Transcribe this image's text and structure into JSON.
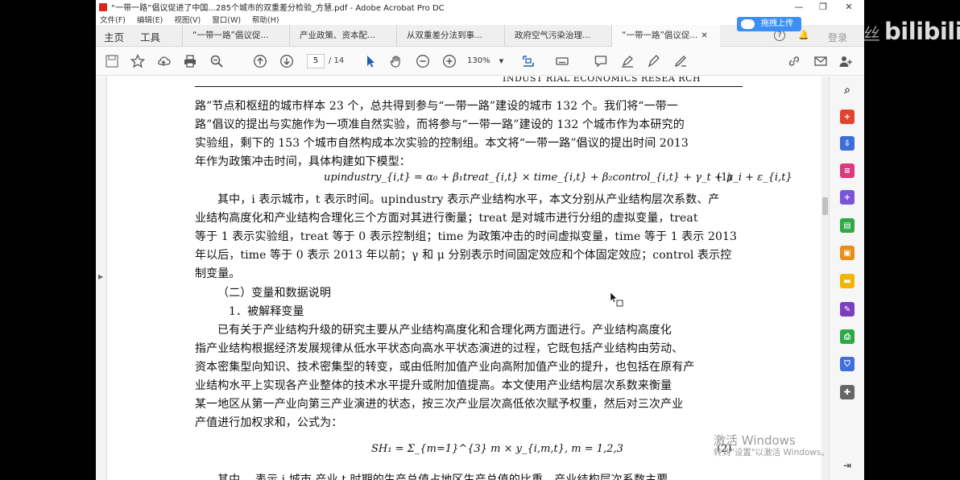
{
  "window": {
    "title": "“一带一路”倡议促进了中国...285个城市的双重差分检验_方慧.pdf - Adobe Acrobat Pro DC",
    "menu": [
      "文件(F)",
      "编辑(E)",
      "视图(V)",
      "窗口(W)",
      "帮助(H)"
    ],
    "controls": {
      "minimize": "—",
      "maximize": "❐",
      "close": "✕"
    }
  },
  "tabs": {
    "home": "主页",
    "tools": "工具",
    "docs": [
      "“一带一路”倡议促...",
      "产业政策、资本配...",
      "从双重差分法到事...",
      "政府空气污染治理...",
      "“一带一路”倡议促..."
    ],
    "active_index": 4,
    "close_glyph": "✕",
    "help": "?",
    "login": "登录"
  },
  "toolbar": {
    "page_current": "5",
    "page_total": "/ 14",
    "zoom": "130%"
  },
  "document": {
    "running_head": "INDUST RIAL ECONOMICS RESEA RCH",
    "lines": [
      "路”节点和枢纽的城市样本 23 个，总共得到参与“一带一路”建设的城市 132 个。我们将“一带一",
      "路”倡议的提出与实施作为一项准自然实验，而将参与“一带一路”建设的 132 个城市作为本研究的",
      "实验组，剩下的 153 个城市自然构成本次实验的控制组。本文将“一带一路”倡议的提出时间 2013",
      "年作为政策冲击时间，具体构建如下模型：",
      "其中，i 表示城市，t 表示时间。upindustry 表示产业结构水平，本文分别从产业结构层次系数、产",
      "业结构高度化和产业结构合理化三个方面对其进行衡量；treat 是对城市进行分组的虚拟变量，treat",
      "等于 1 表示实验组，treat 等于 0 表示控制组；time 为政策冲击的时间虚拟变量，time 等于 1 表示 2013",
      "年以后，time 等于 0 表示 2013 年以前；γ 和 μ 分别表示时间固定效应和个体固定效应；control 表示控",
      "制变量。",
      "（二）变量和数据说明",
      "1．被解释变量",
      "已有关于产业结构升级的研究主要从产业结构高度化和合理化两方面进行。产业结构高度化",
      "指产业结构根据经济发展规律从低水平状态向高水平状态演进的过程，它既包括产业结构由劳动、",
      "资本密集型向知识、技术密集型的转变，或由低附加值产业向高附加值产业的提升，也包括在原有产",
      "业结构水平上实现各产业整体的技术水平提升或附加值提高。本文使用产业结构层次系数来衡量",
      "某一地区从第一产业向第三产业演进的状态，按三次产业层次高低依次赋予权重，然后对三次产业",
      "产值进行加权求和，公式为："
    ],
    "equation1": "upindustry_{i,t} = α₀ + β₁treat_{i,t} × time_{i,t} + β₂control_{i,t} + γ_t + μ_i + ε_{i,t}",
    "equation1_number": "(1)",
    "equation2": "SH₁ = Σ_{m=1}^{3} m × y_{i,m,t}, m = 1,2,3",
    "equation2_number": "(2)",
    "cutoff_line": "其中，    表示 i 城市    产业 t 时期的生产总值占地区生产总值的比重，产业结构层次系数主要"
  },
  "overlays": {
    "upload_button": "拖拽上传",
    "brand": "bilibili",
    "brand_prefix": "丝",
    "activation_title": "激活 Windows",
    "activation_sub": "转到\"设置\"以激活 Windows。"
  }
}
